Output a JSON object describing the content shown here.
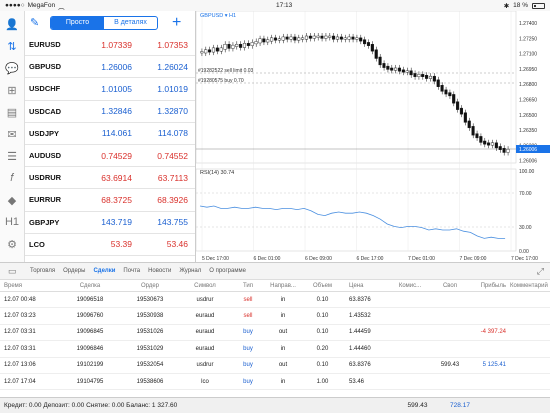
{
  "status": {
    "carrier": "MegaFon",
    "time": "17:13",
    "battery": "18 %"
  },
  "leftbar": {
    "icons": [
      "quotes-icon",
      "chart-icon",
      "chat-icon",
      "new-order-icon",
      "history-icon",
      "mail-icon",
      "journal-icon",
      "indicators-icon",
      "objects-icon",
      "timeframe-icon",
      "settings-icon"
    ]
  },
  "quotes": {
    "tab_simple": "Просто",
    "tab_detail": "В деталях",
    "rows": [
      {
        "symbol": "EURUSD",
        "bid": "1.07339",
        "ask": "1.07353",
        "color": "red"
      },
      {
        "symbol": "GBPUSD",
        "bid": "1.26006",
        "ask": "1.26024",
        "color": "blue"
      },
      {
        "symbol": "USDCHF",
        "bid": "1.01005",
        "ask": "1.01019",
        "color": "blue"
      },
      {
        "symbol": "USDCAD",
        "bid": "1.32846",
        "ask": "1.32870",
        "color": "blue"
      },
      {
        "symbol": "USDJPY",
        "bid": "114.061",
        "ask": "114.078",
        "color": "blue"
      },
      {
        "symbol": "AUDUSD",
        "bid": "0.74529",
        "ask": "0.74552",
        "color": "red"
      },
      {
        "symbol": "USDRUR",
        "bid": "63.6914",
        "ask": "63.7113",
        "color": "red"
      },
      {
        "symbol": "EURRUR",
        "bid": "68.3725",
        "ask": "68.3926",
        "color": "red"
      },
      {
        "symbol": "GBPJPY",
        "bid": "143.719",
        "ask": "143.755",
        "color": "blue"
      },
      {
        "symbol": "LCO",
        "bid": "53.39",
        "ask": "53.46",
        "color": "red"
      }
    ]
  },
  "chart": {
    "title": "GBPUSD ▾ H1",
    "line1": "#19282522 sell limit 0.03",
    "line2": "#19280575 buy 0.70",
    "rsi_title": "RSI(14) 30.74",
    "price_labels": [
      "1.27400",
      "1.27250",
      "1.27100",
      "1.26950",
      "1.26800",
      "1.26650",
      "1.26500",
      "1.26350",
      "1.26200",
      "1.26006"
    ],
    "rsi_labels": [
      "100.00",
      "70.00",
      "30.00",
      "0.00"
    ],
    "time_labels": [
      "5 Dec 17:00",
      "6 Dec 01:00",
      "6 Dec 09:00",
      "6 Dec 17:00",
      "7 Dec 01:00",
      "7 Dec 09:00",
      "7 Dec 17:00"
    ]
  },
  "tabs": [
    "Торговля",
    "Ордеры",
    "Сделки",
    "Почта",
    "Новости",
    "Журнал",
    "О программе"
  ],
  "table": {
    "headers": [
      "Время",
      "Сделка",
      "Ордер",
      "Символ",
      "Тип",
      "Направ...",
      "Объем",
      "Цена",
      "Комис...",
      "Своп",
      "Прибыль",
      "Комментарий"
    ],
    "rows": [
      {
        "time": "12.07 00:48",
        "deal": "19096518",
        "order": "19530673",
        "symbol": "usdrur",
        "type": "sell",
        "dir": "in",
        "volume": "0.10",
        "price": "63.8376",
        "comm": "",
        "swap": "",
        "profit": "",
        "comment": ""
      },
      {
        "time": "12.07 03:23",
        "deal": "19096760",
        "order": "19530938",
        "symbol": "euraud",
        "type": "sell",
        "dir": "in",
        "volume": "0.10",
        "price": "1.43532",
        "comm": "",
        "swap": "",
        "profit": "",
        "comment": ""
      },
      {
        "time": "12.07 03:31",
        "deal": "19096845",
        "order": "19531026",
        "symbol": "euraud",
        "type": "buy",
        "dir": "out",
        "volume": "0.10",
        "price": "1.44459",
        "comm": "",
        "swap": "",
        "profit": "-4 397.24",
        "comment": ""
      },
      {
        "time": "12.07 03:31",
        "deal": "19096846",
        "order": "19531029",
        "symbol": "euraud",
        "type": "buy",
        "dir": "in",
        "volume": "0.20",
        "price": "1.44460",
        "comm": "",
        "swap": "",
        "profit": "",
        "comment": ""
      },
      {
        "time": "12.07 13:06",
        "deal": "19102199",
        "order": "19532054",
        "symbol": "usdrur",
        "type": "buy",
        "dir": "out",
        "volume": "0.10",
        "price": "63.8376",
        "comm": "",
        "swap": "599.43",
        "profit": "5 125.41",
        "comment": ""
      },
      {
        "time": "12.07 17:04",
        "deal": "19104795",
        "order": "19538606",
        "symbol": "lco",
        "type": "buy",
        "dir": "in",
        "volume": "1.00",
        "price": "53.46",
        "comm": "",
        "swap": "",
        "profit": "",
        "comment": ""
      }
    ]
  },
  "footer": {
    "text": "Кредит: 0.00 Депозит: 0.00 Снятие: 0.00 Баланс: 1 327.60",
    "swap_total": "599.43",
    "profit_total": "728.17"
  },
  "colors": {
    "accent": "#1a73e8",
    "sell": "#d9302b",
    "buy": "#1a5fd0"
  }
}
